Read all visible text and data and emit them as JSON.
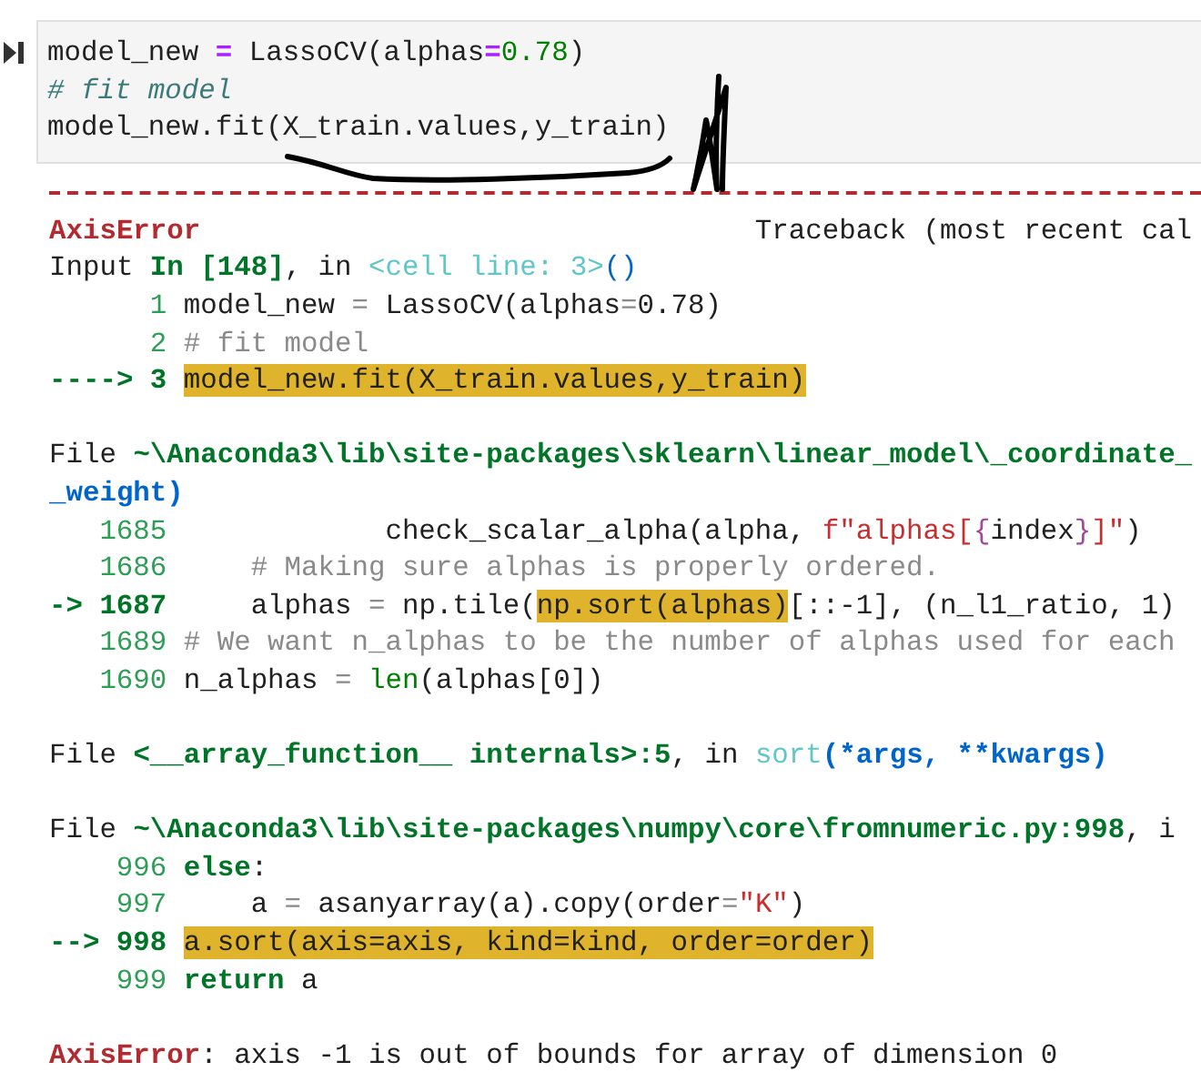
{
  "cell": {
    "lines": [
      [
        {
          "text": "model_new ",
          "kind": "plain"
        },
        {
          "text": "=",
          "kind": "op"
        },
        {
          "text": " LassoCV(alphas",
          "kind": "plain"
        },
        {
          "text": "=",
          "kind": "op"
        },
        {
          "text": "0.78",
          "kind": "num"
        },
        {
          "text": ")",
          "kind": "plain"
        }
      ],
      [
        {
          "text": "# fit model",
          "kind": "note"
        }
      ],
      [
        {
          "text": "model_new.fit(X_train.values,y_train)",
          "kind": "plain"
        }
      ]
    ]
  },
  "traceback": {
    "error": "AxisError",
    "label": "Traceback (most recent cal",
    "blocks": [
      [
        {
          "kind": "text",
          "segments": [
            {
              "text": "Input ",
              "kind": "plain"
            },
            {
              "text": "In [148]",
              "kind": "kw"
            },
            {
              "text": ", in ",
              "kind": "plain"
            },
            {
              "text": "<cell line: 3>",
              "kind": "func"
            },
            {
              "text": "()",
              "kind": "call"
            }
          ]
        },
        {
          "kind": "source",
          "number": "1",
          "current": false,
          "code": [
            {
              "text": "model_new ",
              "kind": "plain"
            },
            {
              "text": "=",
              "kind": "dim"
            },
            {
              "text": " LassoCV(alphas",
              "kind": "plain"
            },
            {
              "text": "=",
              "kind": "dim"
            },
            {
              "text": "0.78)",
              "kind": "plain"
            }
          ]
        },
        {
          "kind": "source",
          "number": "2",
          "current": false,
          "code": [
            {
              "text": "# fit model",
              "kind": "comment"
            }
          ]
        },
        {
          "kind": "source",
          "arrow": "---->",
          "number": "3",
          "current": true,
          "code": [
            {
              "text": "model_new.fit(X_train.values,y_train)",
              "kind": "hl"
            }
          ]
        }
      ],
      [
        {
          "kind": "text",
          "segments": [
            {
              "text": "File ",
              "kind": "plain"
            },
            {
              "text": "~\\Anaconda3\\lib\\site-packages\\sklearn\\linear_model\\_coordinate_",
              "kind": "path"
            }
          ]
        },
        {
          "kind": "text",
          "segments": [
            {
              "text": "_weight)",
              "kind": "params"
            }
          ]
        },
        {
          "kind": "source",
          "number": "1685",
          "current": false,
          "code": [
            {
              "text": "            check_scalar_alpha(alpha, ",
              "kind": "plain"
            },
            {
              "text": "f\"alphas[",
              "kind": "str"
            },
            {
              "text": "{",
              "kind": "brace"
            },
            {
              "text": "index",
              "kind": "plain"
            },
            {
              "text": "}",
              "kind": "brace"
            },
            {
              "text": "]\"",
              "kind": "str"
            },
            {
              "text": ")",
              "kind": "plain"
            }
          ]
        },
        {
          "kind": "source",
          "number": "1686",
          "current": false,
          "code": [
            {
              "text": "    # Making sure alphas is properly ordered.",
              "kind": "comment"
            }
          ]
        },
        {
          "kind": "source",
          "arrow": "->",
          "number": "1687",
          "current": true,
          "code": [
            {
              "text": "    alphas ",
              "kind": "plain"
            },
            {
              "text": "=",
              "kind": "dim"
            },
            {
              "text": " np.tile(",
              "kind": "plain"
            },
            {
              "text": "np.sort(alphas)",
              "kind": "hl"
            },
            {
              "text": "[::-1], (n_l1_ratio, 1)",
              "kind": "plain"
            }
          ]
        },
        {
          "kind": "source",
          "number": "1689",
          "current": false,
          "code": [
            {
              "text": "# We want n_alphas to be the number of alphas used for each",
              "kind": "comment"
            }
          ]
        },
        {
          "kind": "source",
          "number": "1690",
          "current": false,
          "code": [
            {
              "text": "n_alphas ",
              "kind": "plain"
            },
            {
              "text": "= ",
              "kind": "dim"
            },
            {
              "text": "len",
              "kind": "builtin"
            },
            {
              "text": "(alphas[0])",
              "kind": "plain"
            }
          ]
        }
      ],
      [
        {
          "kind": "text",
          "segments": [
            {
              "text": "File ",
              "kind": "plain"
            },
            {
              "text": "<__array_function__ internals>:5",
              "kind": "path"
            },
            {
              "text": ", in ",
              "kind": "plain"
            },
            {
              "text": "sort",
              "kind": "func"
            },
            {
              "text": "(*args, **kwargs)",
              "kind": "params"
            }
          ]
        }
      ],
      [
        {
          "kind": "text",
          "segments": [
            {
              "text": "File ",
              "kind": "plain"
            },
            {
              "text": "~\\Anaconda3\\lib\\site-packages\\numpy\\core\\fromnumeric.py:998",
              "kind": "path"
            },
            {
              "text": ", i",
              "kind": "plain"
            }
          ]
        },
        {
          "kind": "source",
          "number": "996",
          "current": false,
          "code": [
            {
              "text": "else",
              "kind": "kw"
            },
            {
              "text": ":",
              "kind": "plain"
            }
          ]
        },
        {
          "kind": "source",
          "number": "997",
          "current": false,
          "code": [
            {
              "text": "    a ",
              "kind": "plain"
            },
            {
              "text": "=",
              "kind": "dim"
            },
            {
              "text": " asanyarray(a).copy(order",
              "kind": "plain"
            },
            {
              "text": "=",
              "kind": "dim"
            },
            {
              "text": "\"K\"",
              "kind": "str"
            },
            {
              "text": ")",
              "kind": "plain"
            }
          ]
        },
        {
          "kind": "source",
          "arrow": "-->",
          "number": "998",
          "current": true,
          "code": [
            {
              "text": "a.sort(axis=axis, kind=kind, order=order)",
              "kind": "hl"
            }
          ]
        },
        {
          "kind": "source",
          "number": "999",
          "current": false,
          "code": [
            {
              "text": "return",
              "kind": "kw"
            },
            {
              "text": " a",
              "kind": "plain"
            }
          ]
        }
      ],
      [
        {
          "kind": "text",
          "segments": [
            {
              "text": "AxisError",
              "kind": "error"
            },
            {
              "text": ": axis -1 is out of bounds for array of dimension 0",
              "kind": "plain"
            }
          ]
        }
      ]
    ]
  }
}
